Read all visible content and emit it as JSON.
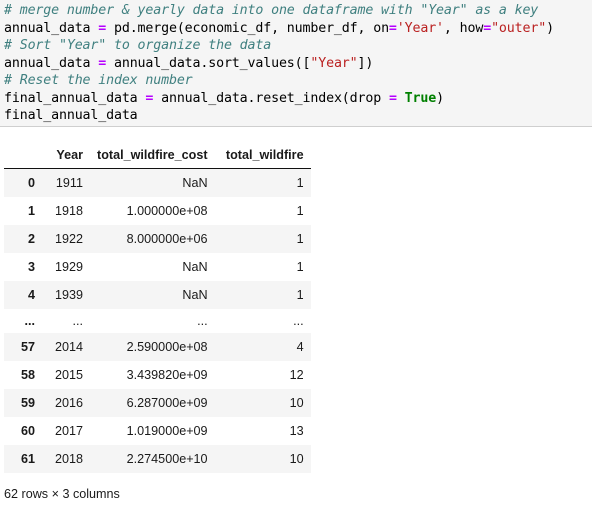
{
  "code_cell": {
    "background": "#f5f5f5",
    "colors": {
      "comment": "#408080",
      "operator": "#b500ff",
      "string": "#ba2121",
      "keyword": "#008000",
      "text": "#000000"
    },
    "lines": [
      {
        "tokens": [
          {
            "t": "comment",
            "v": "# merge number & yearly data into one dataframe with \"Year\" as a key"
          }
        ]
      },
      {
        "tokens": [
          {
            "t": "plain",
            "v": "annual_data "
          },
          {
            "t": "op",
            "v": "="
          },
          {
            "t": "plain",
            "v": " pd.merge(economic_df, number_df, on"
          },
          {
            "t": "op",
            "v": "="
          },
          {
            "t": "str",
            "v": "'Year'"
          },
          {
            "t": "plain",
            "v": ", how"
          },
          {
            "t": "op",
            "v": "="
          },
          {
            "t": "str",
            "v": "\"outer\""
          },
          {
            "t": "plain",
            "v": ")"
          }
        ]
      },
      {
        "tokens": [
          {
            "t": "comment",
            "v": "# Sort \"Year\" to organize the data"
          }
        ]
      },
      {
        "tokens": [
          {
            "t": "plain",
            "v": "annual_data "
          },
          {
            "t": "op",
            "v": "="
          },
          {
            "t": "plain",
            "v": " annual_data.sort_values(["
          },
          {
            "t": "str",
            "v": "\"Year\""
          },
          {
            "t": "plain",
            "v": "])"
          }
        ]
      },
      {
        "tokens": [
          {
            "t": "comment",
            "v": "# Reset the index number"
          }
        ]
      },
      {
        "tokens": [
          {
            "t": "plain",
            "v": "final_annual_data "
          },
          {
            "t": "op",
            "v": "="
          },
          {
            "t": "plain",
            "v": " annual_data.reset_index(drop "
          },
          {
            "t": "op",
            "v": "="
          },
          {
            "t": "plain",
            "v": " "
          },
          {
            "t": "kw",
            "v": "True"
          },
          {
            "t": "plain",
            "v": ")"
          }
        ]
      },
      {
        "tokens": [
          {
            "t": "plain",
            "v": "final_annual_data"
          }
        ]
      }
    ]
  },
  "dataframe": {
    "index_header": "",
    "columns": [
      "Year",
      "total_wildfire_cost",
      "total_wildfire"
    ],
    "rows": [
      {
        "index": "0",
        "cells": [
          "1911",
          "NaN",
          "1"
        ]
      },
      {
        "index": "1",
        "cells": [
          "1918",
          "1.000000e+08",
          "1"
        ]
      },
      {
        "index": "2",
        "cells": [
          "1922",
          "8.000000e+06",
          "1"
        ]
      },
      {
        "index": "3",
        "cells": [
          "1929",
          "NaN",
          "1"
        ]
      },
      {
        "index": "4",
        "cells": [
          "1939",
          "NaN",
          "1"
        ]
      },
      {
        "index": "...",
        "cells": [
          "...",
          "...",
          "..."
        ],
        "ellipsis": true
      },
      {
        "index": "57",
        "cells": [
          "2014",
          "2.590000e+08",
          "4"
        ]
      },
      {
        "index": "58",
        "cells": [
          "2015",
          "3.439820e+09",
          "12"
        ]
      },
      {
        "index": "59",
        "cells": [
          "2016",
          "6.287000e+09",
          "10"
        ]
      },
      {
        "index": "60",
        "cells": [
          "2017",
          "1.019000e+09",
          "13"
        ]
      },
      {
        "index": "61",
        "cells": [
          "2018",
          "2.274500e+10",
          "10"
        ]
      }
    ],
    "footer": "62 rows × 3 columns"
  }
}
